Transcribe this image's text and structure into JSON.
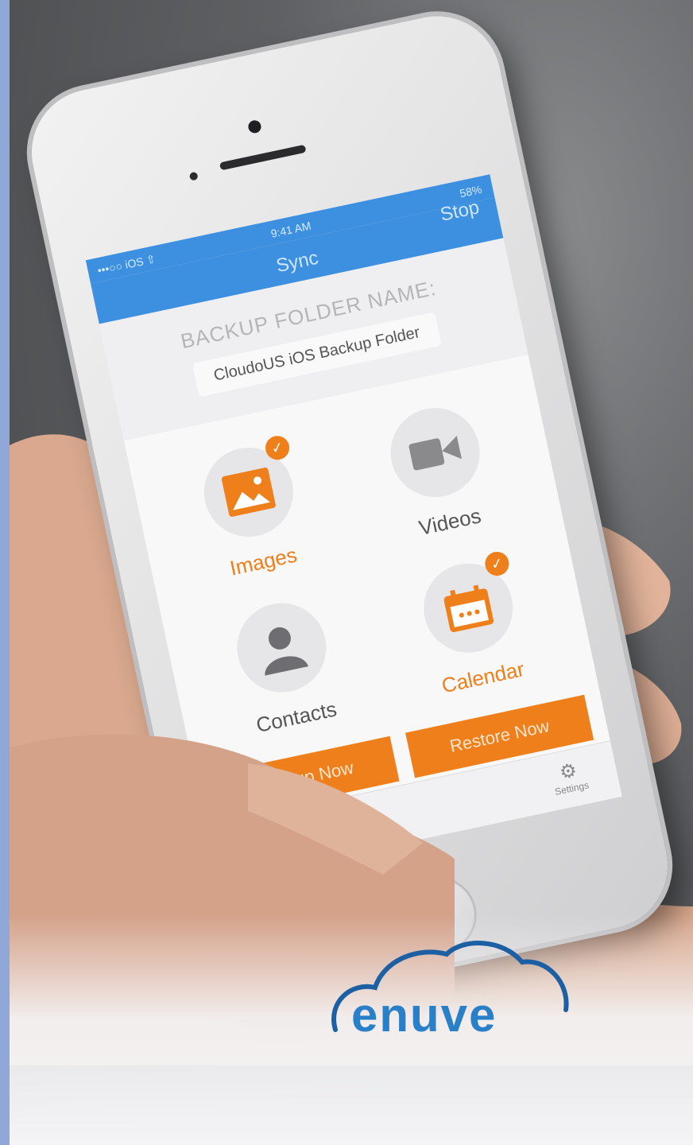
{
  "app": {
    "status": {
      "carrier": "•••○○ iOS ⇧",
      "time": "9:41 AM",
      "battery": "58%"
    },
    "nav": {
      "title": "Sync",
      "stop_label": "Stop"
    },
    "folder": {
      "label": "BACKUP FOLDER NAME:",
      "value": "CloudoUS iOS Backup Folder"
    },
    "items": [
      {
        "label": "Images",
        "icon": "image-icon",
        "selected": true
      },
      {
        "label": "Videos",
        "icon": "video-camera-icon",
        "selected": false
      },
      {
        "label": "Contacts",
        "icon": "person-icon",
        "selected": false
      },
      {
        "label": "Calendar",
        "icon": "calendar-icon",
        "selected": true
      }
    ],
    "buttons": {
      "backup_label": "Backup Now",
      "restore_label": "Restore Now"
    },
    "tabbar": {
      "settings_label": "Settings"
    }
  },
  "logo": {
    "text": "enuve"
  },
  "colors": {
    "accent": "#ef7f1a",
    "nav_blue": "#3d8fe0",
    "logo_blue": "#2a7fc9",
    "sidebar": "#8fa8d8"
  }
}
